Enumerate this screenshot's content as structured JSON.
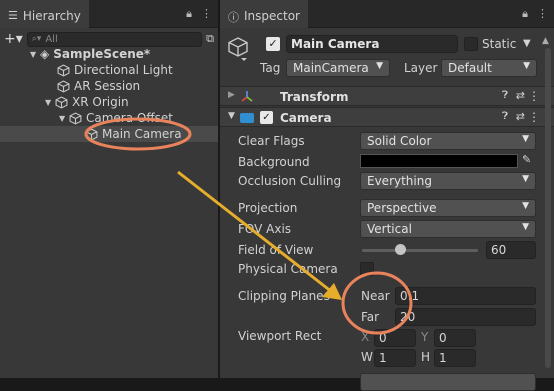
{
  "hierarchy": {
    "tab_label": "Hierarchy",
    "search_placeholder": "All",
    "items": [
      {
        "label": "SampleScene*"
      },
      {
        "label": "Directional Light"
      },
      {
        "label": "AR Session"
      },
      {
        "label": "XR Origin"
      },
      {
        "label": "Camera Offset"
      },
      {
        "label": "Main Camera"
      }
    ]
  },
  "inspector": {
    "tab_label": "Inspector",
    "object_name": "Main Camera",
    "static_label": "Static",
    "tag_label": "Tag",
    "tag_value": "MainCamera",
    "layer_label": "Layer",
    "layer_value": "Default",
    "transform_title": "Transform",
    "camera_title": "Camera",
    "fields": {
      "clear_flags_label": "Clear Flags",
      "clear_flags_value": "Solid Color",
      "background_label": "Background",
      "culling_label": "Occlusion Culling",
      "culling_value": "Everything",
      "projection_label": "Projection",
      "projection_value": "Perspective",
      "fov_axis_label": "FOV Axis",
      "fov_axis_value": "Vertical",
      "fov_label": "Field of View",
      "fov_value": "60",
      "physical_label": "Physical Camera",
      "clipping_label": "Clipping Planes",
      "near_label": "Near",
      "near_value": "0.1",
      "far_label": "Far",
      "far_value": "20",
      "viewport_label": "Viewport Rect",
      "x_label": "X",
      "x_value": "0",
      "y_label": "Y",
      "y_value": "0",
      "w_label": "W",
      "w_value": "1",
      "h_label": "H",
      "h_value": "1"
    }
  },
  "colors": {
    "annotation": "#e8835c",
    "arrow": "#e6ad2c",
    "panel": "#383838",
    "header": "#3e3e3e"
  },
  "slider_fraction": 0.33
}
